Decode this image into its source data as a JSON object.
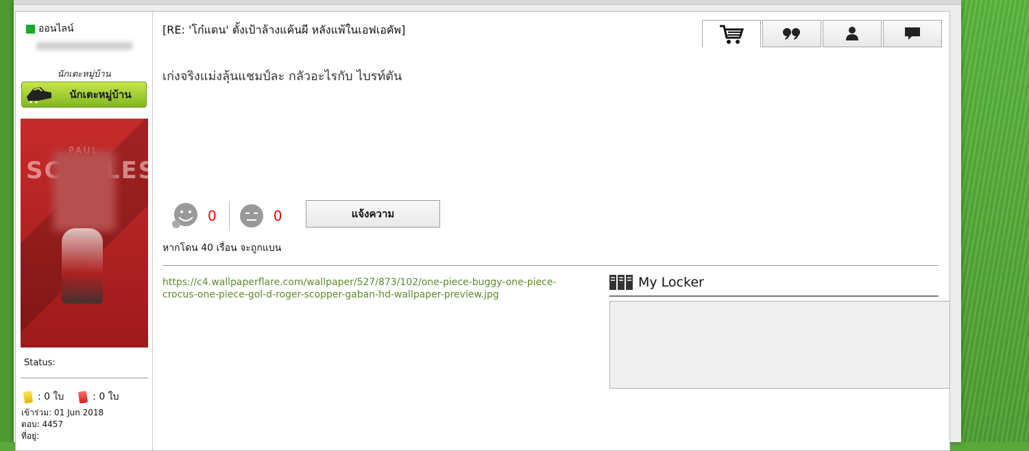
{
  "user": {
    "online_label": "ออนไลน์",
    "rank_title": "นักเตะหมู่บ้าน",
    "rank_badge_label": "นักเตะหมู่บ้าน",
    "avatar_text_top": "PAUL",
    "avatar_text": "SCHOLES",
    "status_label": "Status:",
    "yellow_cards": ": 0 ใบ",
    "red_cards": ": 0 ใบ",
    "joined": "เข้าร่วม: 01 Jun 2018",
    "replies": "ตอบ: 4457",
    "location": "ที่อยู่:"
  },
  "post": {
    "title": "[RE: 'โก๋แดน' ตั้งเป้าล้างแค้นผี หลังแพ้ในเอฟเอคัพ]",
    "body": "เก่งจริงแม่งลุ้นแชมป์ละ กลัวอะไรกับ ไบรท์ตัน",
    "like_count": "0",
    "dislike_count": "0",
    "report_label": "แจ้งความ",
    "ban_warning": "หากโดน 40 เรื่อน จะถูกแบน",
    "signature_link": "https://c4.wallpaperflare.com/wallpaper/527/873/102/one-piece-buggy-one-piece-crocus-one-piece-gol-d-roger-scopper-gaban-hd-wallpaper-preview.jpg",
    "locker_title": "My Locker"
  },
  "actions": {
    "icons": [
      "cart-icon",
      "quote-icon",
      "user-icon",
      "comment-icon"
    ]
  },
  "colors": {
    "online": "#1aaa2b",
    "vote_count": "#ee0000",
    "link": "#5c8a2a"
  }
}
